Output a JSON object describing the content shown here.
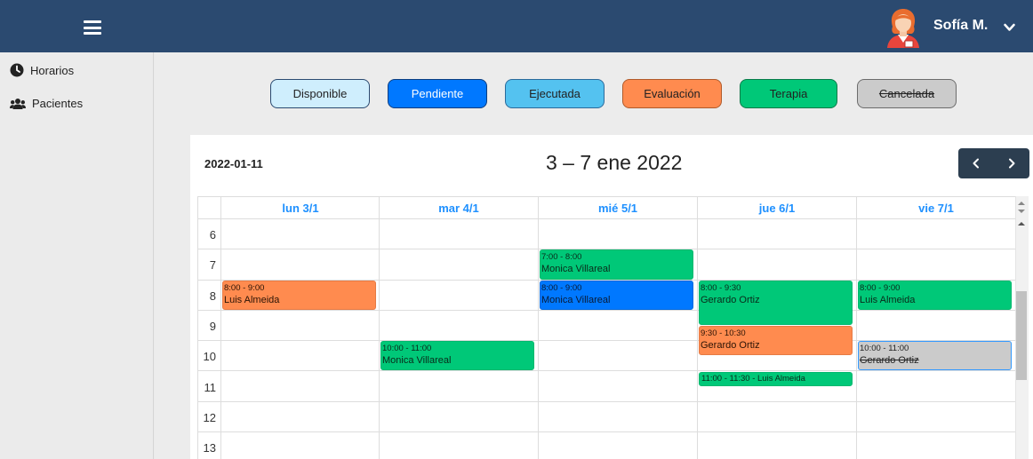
{
  "header": {
    "user_name": "Sofía M."
  },
  "sidebar": {
    "items": [
      {
        "label": "Horarios",
        "icon": "clock-icon"
      },
      {
        "label": "Pacientes",
        "icon": "users-icon"
      }
    ]
  },
  "legend": [
    {
      "label": "Disponible",
      "bg": "#cfeefd",
      "border": "#2b4a70",
      "color": "#222222",
      "strike": false
    },
    {
      "label": "Pendiente",
      "bg": "#0078ff",
      "border": "#0a3d80",
      "color": "#ffffff",
      "strike": false
    },
    {
      "label": "Ejecutada",
      "bg": "#54c2f0",
      "border": "#2b6a9b",
      "color": "#222222",
      "strike": false
    },
    {
      "label": "Evaluación",
      "bg": "#ff8b4f",
      "border": "#b05a2a",
      "color": "#222222",
      "strike": false
    },
    {
      "label": "Terapia",
      "bg": "#00c878",
      "border": "#087a48",
      "color": "#222222",
      "strike": false
    },
    {
      "label": "Cancelada",
      "bg": "#cbcbcb",
      "border": "#6c6c6c",
      "color": "#222222",
      "strike": true
    }
  ],
  "calendar": {
    "date": "2022-01-11",
    "title": "3 – 7 ene 2022",
    "days": [
      "lun 3/1",
      "mar 4/1",
      "mié 5/1",
      "jue 6/1",
      "vie 7/1"
    ],
    "hours": [
      "6",
      "7",
      "8",
      "9",
      "10",
      "11",
      "12",
      "13"
    ],
    "events": [
      {
        "day": 0,
        "start": 8,
        "end": 9,
        "time": "8:00 - 9:00",
        "name": "Luis Almeida",
        "kind": "orange",
        "strike": false
      },
      {
        "day": 1,
        "start": 10,
        "end": 11,
        "time": "10:00 - 11:00",
        "name": "Monica Villareal",
        "kind": "green",
        "strike": false
      },
      {
        "day": 2,
        "start": 7,
        "end": 8,
        "time": "7:00 - 8:00",
        "name": "Monica Villareal",
        "kind": "green",
        "strike": false
      },
      {
        "day": 2,
        "start": 8,
        "end": 9,
        "time": "8:00 - 9:00",
        "name": "Monica Villareal",
        "kind": "blue",
        "strike": false
      },
      {
        "day": 3,
        "start": 8,
        "end": 9.5,
        "time": "8:00 - 9:30",
        "name": "Gerardo Ortiz",
        "kind": "green",
        "strike": false
      },
      {
        "day": 3,
        "start": 9.5,
        "end": 10.5,
        "time": "9:30 - 10:30",
        "name": "Gerardo Ortiz",
        "kind": "orange",
        "strike": false
      },
      {
        "day": 3,
        "start": 11,
        "end": 11.5,
        "time": "11:00 - 11:30 - Luis Almeida",
        "name": "",
        "kind": "green",
        "strike": false,
        "inline": true
      },
      {
        "day": 4,
        "start": 8,
        "end": 9,
        "time": "8:00 - 9:00",
        "name": "Luis Almeida",
        "kind": "green",
        "strike": false
      },
      {
        "day": 4,
        "start": 10,
        "end": 11,
        "time": "10:00 - 11:00",
        "name": "Gerardo Ortiz",
        "kind": "gray",
        "strike": true
      }
    ]
  }
}
